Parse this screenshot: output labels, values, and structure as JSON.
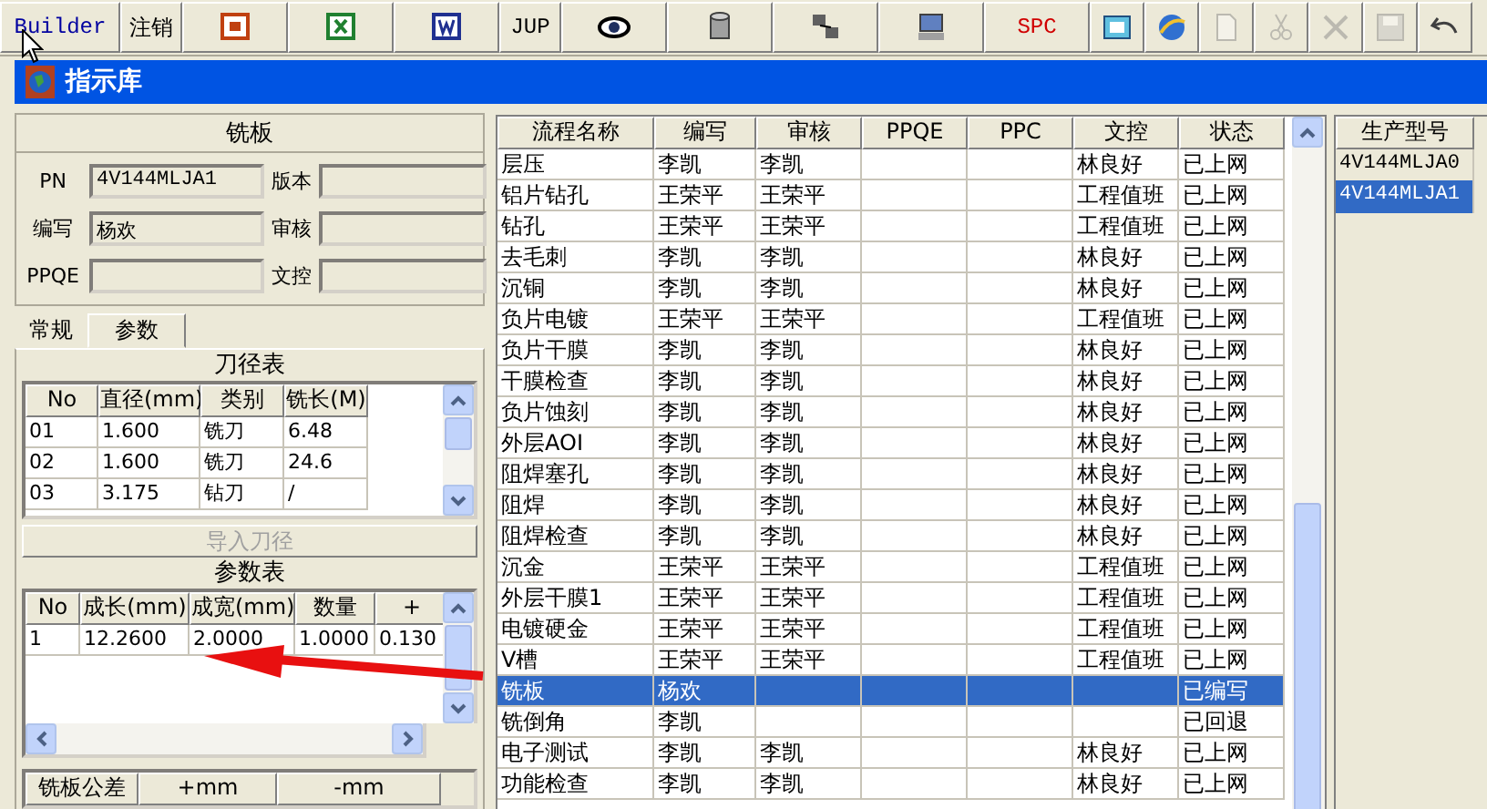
{
  "toolbar": [
    {
      "kind": "text",
      "label": "Builder"
    },
    {
      "kind": "text",
      "label": "注销"
    },
    {
      "kind": "icon",
      "disabled": false
    },
    {
      "kind": "icon",
      "disabled": false
    },
    {
      "kind": "icon",
      "disabled": false
    },
    {
      "kind": "text",
      "label": "JUP"
    },
    {
      "kind": "icon",
      "disabled": false
    },
    {
      "kind": "icon",
      "disabled": false
    },
    {
      "kind": "icon",
      "disabled": false
    },
    {
      "kind": "icon",
      "disabled": false
    },
    {
      "kind": "text",
      "label": "SPC"
    },
    {
      "kind": "icon",
      "disabled": false
    },
    {
      "kind": "icon",
      "disabled": false
    },
    {
      "kind": "icon",
      "disabled": true
    },
    {
      "kind": "icon",
      "disabled": true
    },
    {
      "kind": "icon",
      "disabled": true
    },
    {
      "kind": "icon",
      "disabled": true
    },
    {
      "kind": "icon",
      "disabled": false
    }
  ],
  "window": {
    "title": "指示库"
  },
  "form": {
    "title": "铣板",
    "fields": [
      {
        "label": "PN",
        "value": "4V144MLJA1"
      },
      {
        "label": "版本"
      },
      {
        "label": "编写",
        "value": "杨欢"
      },
      {
        "label": "审核"
      },
      {
        "label": "PPQE"
      },
      {
        "label": "文控"
      }
    ]
  },
  "tabs": [
    {
      "label": "常规",
      "selected": false
    },
    {
      "label": "参数",
      "selected": true
    }
  ],
  "cutter_table": {
    "title": "刀径表",
    "columns": [
      "No",
      "直径(mm)",
      "类别",
      "铣长(M)"
    ],
    "rows": [
      [
        "01",
        "1.600",
        "铣刀",
        "6.48"
      ],
      [
        "02",
        "1.600",
        "铣刀",
        "24.6"
      ],
      [
        "03",
        "3.175",
        "钻刀",
        "/"
      ]
    ]
  },
  "import_button": {
    "label": "导入刀径",
    "disabled": true
  },
  "param_table": {
    "title": "参数表",
    "columns": [
      "No",
      "成长(mm)",
      "成宽(mm)",
      "数量",
      "+"
    ],
    "rows": [
      [
        "1",
        "12.2600",
        "2.0000",
        "1.0000",
        "0.130"
      ]
    ]
  },
  "tolerance_table": {
    "columns": [
      "铣板公差",
      "+mm",
      "-mm"
    ]
  },
  "process_table": {
    "columns": [
      "流程名称",
      "编写",
      "审核",
      "PPQE",
      "PPC",
      "文控",
      "状态"
    ],
    "rows": [
      {
        "cells": [
          "层压",
          "李凯",
          "李凯",
          "",
          "",
          "林良好",
          "已上网"
        ],
        "selected": false
      },
      {
        "cells": [
          "铝片钻孔",
          "王荣平",
          "王荣平",
          "",
          "",
          "工程值班",
          "已上网"
        ],
        "selected": false
      },
      {
        "cells": [
          "钻孔",
          "王荣平",
          "王荣平",
          "",
          "",
          "工程值班",
          "已上网"
        ],
        "selected": false
      },
      {
        "cells": [
          "去毛刺",
          "李凯",
          "李凯",
          "",
          "",
          "林良好",
          "已上网"
        ],
        "selected": false
      },
      {
        "cells": [
          "沉铜",
          "李凯",
          "李凯",
          "",
          "",
          "林良好",
          "已上网"
        ],
        "selected": false
      },
      {
        "cells": [
          "负片电镀",
          "王荣平",
          "王荣平",
          "",
          "",
          "工程值班",
          "已上网"
        ],
        "selected": false
      },
      {
        "cells": [
          "负片干膜",
          "李凯",
          "李凯",
          "",
          "",
          "林良好",
          "已上网"
        ],
        "selected": false
      },
      {
        "cells": [
          "干膜检查",
          "李凯",
          "李凯",
          "",
          "",
          "林良好",
          "已上网"
        ],
        "selected": false
      },
      {
        "cells": [
          "负片蚀刻",
          "李凯",
          "李凯",
          "",
          "",
          "林良好",
          "已上网"
        ],
        "selected": false
      },
      {
        "cells": [
          "外层AOI",
          "李凯",
          "李凯",
          "",
          "",
          "林良好",
          "已上网"
        ],
        "selected": false
      },
      {
        "cells": [
          "阻焊塞孔",
          "李凯",
          "李凯",
          "",
          "",
          "林良好",
          "已上网"
        ],
        "selected": false
      },
      {
        "cells": [
          "阻焊",
          "李凯",
          "李凯",
          "",
          "",
          "林良好",
          "已上网"
        ],
        "selected": false
      },
      {
        "cells": [
          "阻焊检查",
          "李凯",
          "李凯",
          "",
          "",
          "林良好",
          "已上网"
        ],
        "selected": false
      },
      {
        "cells": [
          "沉金",
          "王荣平",
          "王荣平",
          "",
          "",
          "工程值班",
          "已上网"
        ],
        "selected": false
      },
      {
        "cells": [
          "外层干膜1",
          "王荣平",
          "王荣平",
          "",
          "",
          "工程值班",
          "已上网"
        ],
        "selected": false
      },
      {
        "cells": [
          "电镀硬金",
          "王荣平",
          "王荣平",
          "",
          "",
          "工程值班",
          "已上网"
        ],
        "selected": false
      },
      {
        "cells": [
          "V槽",
          "王荣平",
          "王荣平",
          "",
          "",
          "工程值班",
          "已上网"
        ],
        "selected": false
      },
      {
        "cells": [
          "铣板",
          "杨欢",
          "",
          "",
          "",
          "",
          "已编写"
        ],
        "selected": true
      },
      {
        "cells": [
          "铣倒角",
          "李凯",
          "",
          "",
          "",
          "",
          "已回退"
        ],
        "selected": false
      },
      {
        "cells": [
          "电子测试",
          "李凯",
          "李凯",
          "",
          "",
          "林良好",
          "已上网"
        ],
        "selected": false
      },
      {
        "cells": [
          "功能检查",
          "李凯",
          "李凯",
          "",
          "",
          "林良好",
          "已上网"
        ],
        "selected": false
      }
    ]
  },
  "model_list": {
    "columns": [
      "生产型号"
    ],
    "items": [
      {
        "label": "4V144MLJA0",
        "selected": false
      },
      {
        "label": "4V144MLJA1",
        "selected": true
      }
    ]
  }
}
